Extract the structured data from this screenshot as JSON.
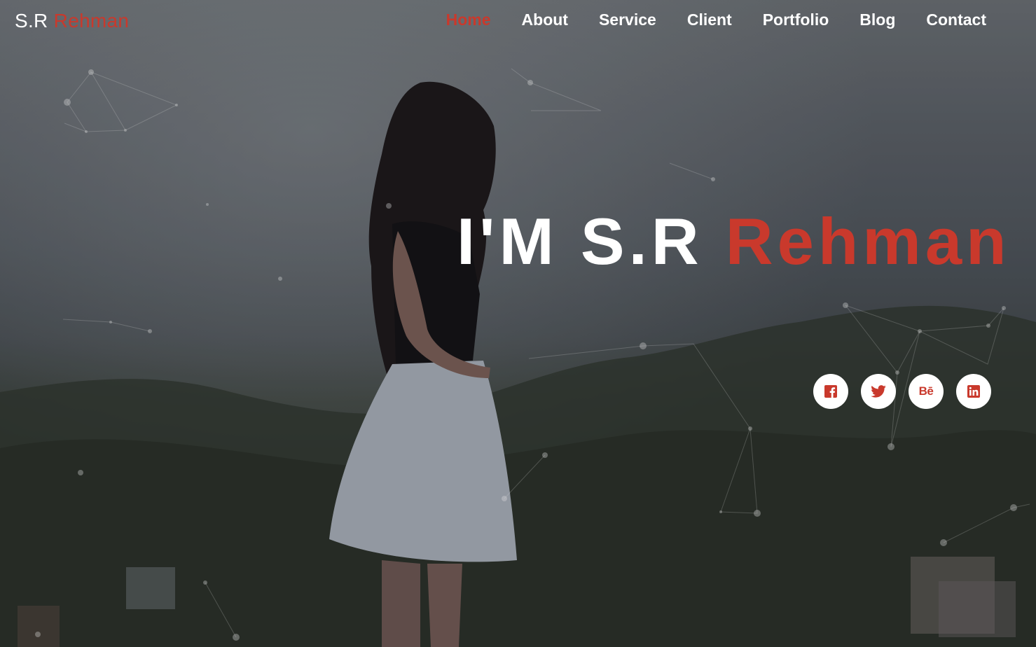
{
  "brand": {
    "first": "S.R",
    "last": "Rehman"
  },
  "nav": {
    "items": [
      {
        "label": "Home",
        "active": true
      },
      {
        "label": "About",
        "active": false
      },
      {
        "label": "Service",
        "active": false
      },
      {
        "label": "Client",
        "active": false
      },
      {
        "label": "Portfolio",
        "active": false
      },
      {
        "label": "Blog",
        "active": false
      },
      {
        "label": "Contact",
        "active": false
      }
    ]
  },
  "hero": {
    "headline_white": "I'M S.R",
    "headline_accent": "Rehman"
  },
  "social": {
    "behance_text": "Bē",
    "icons": [
      "facebook-icon",
      "twitter-icon",
      "behance-icon",
      "linkedin-icon"
    ]
  },
  "colors": {
    "accent": "#c9392c",
    "text": "#ffffff"
  }
}
